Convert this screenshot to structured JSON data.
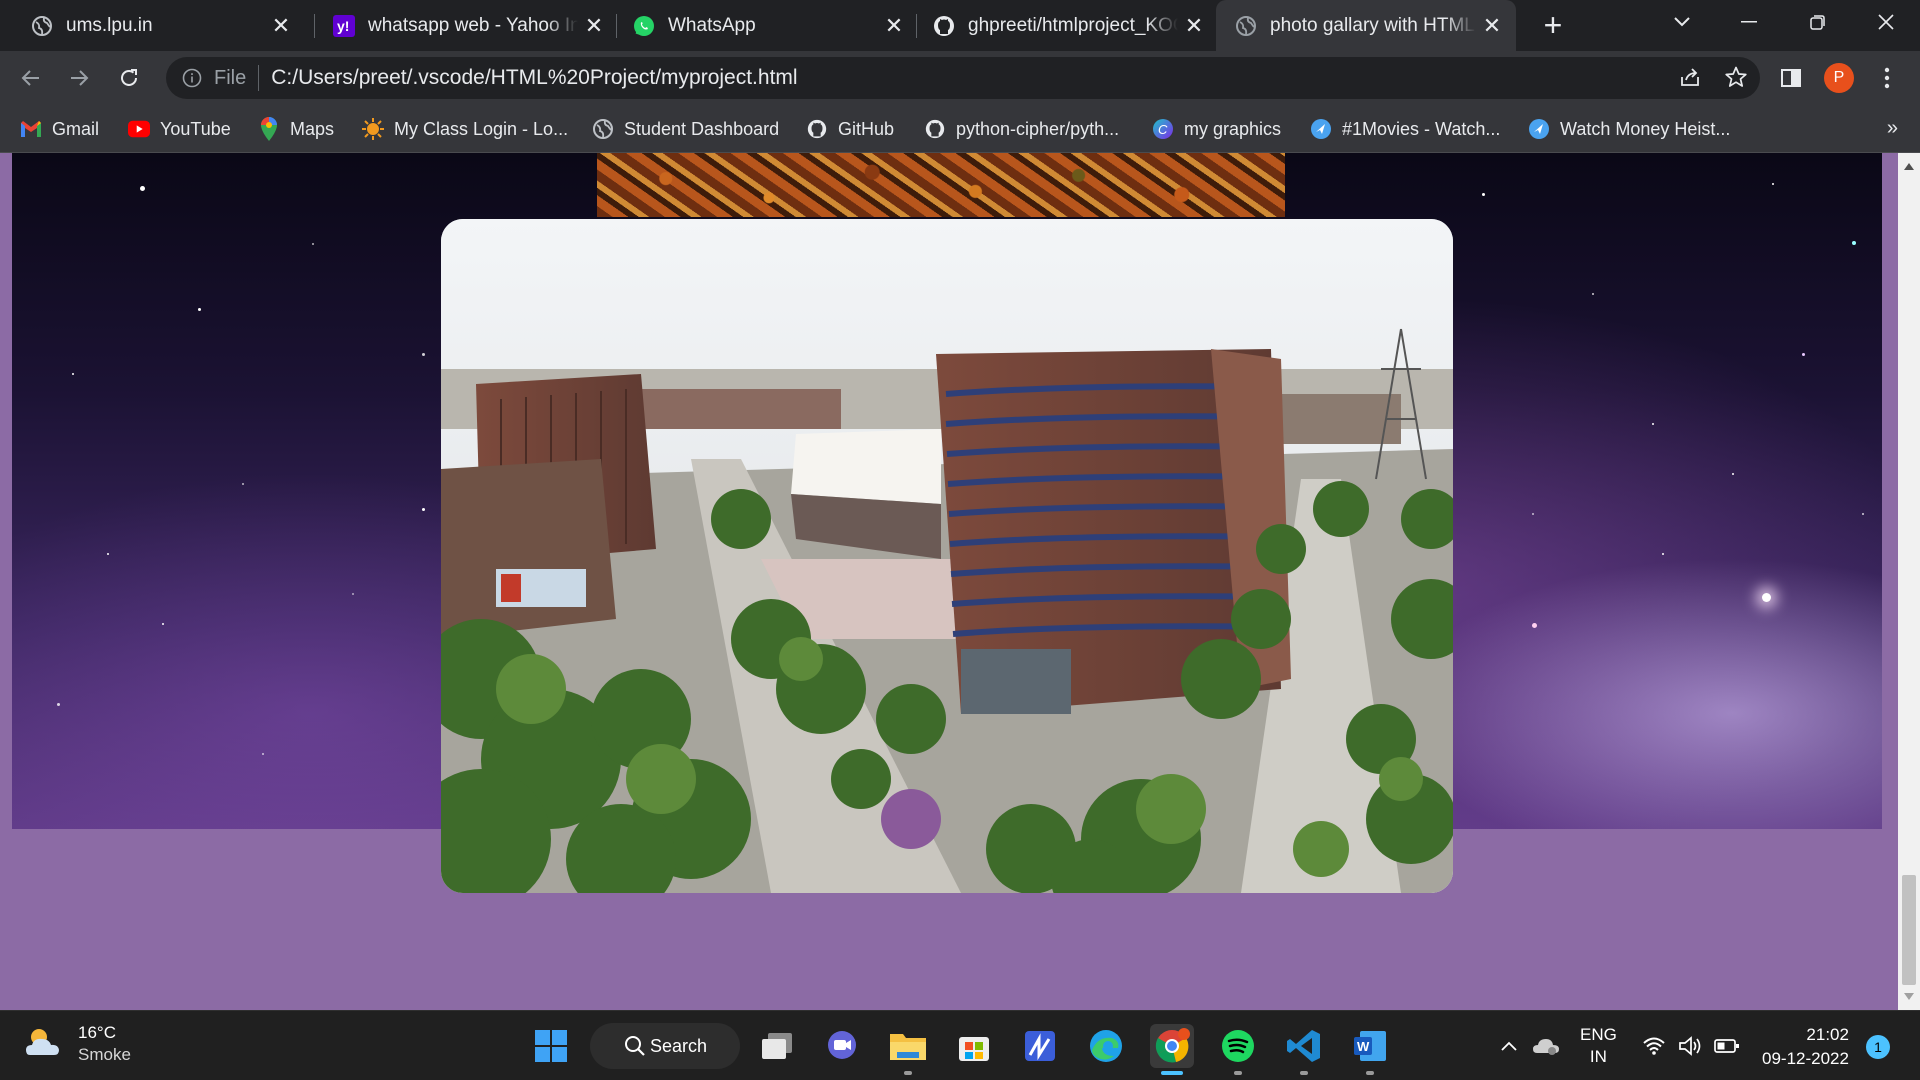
{
  "browser": {
    "tabs": [
      {
        "title": "ums.lpu.in",
        "icon": "globe-icon"
      },
      {
        "title": "whatsapp web - Yahoo India Search",
        "icon": "yahoo-icon"
      },
      {
        "title": "WhatsApp",
        "icon": "whatsapp-icon"
      },
      {
        "title": "ghpreeti/htmlproject_KOOL",
        "icon": "github-icon"
      },
      {
        "title": "photo gallary with HTML and CSS",
        "icon": "globe-icon",
        "active": true
      }
    ],
    "address": {
      "scheme_label": "File",
      "url": "C:/Users/preet/.vscode/HTML%20Project/myproject.html"
    },
    "profile_initial": "P",
    "bookmarks": [
      {
        "label": "Gmail",
        "icon": "gmail-icon"
      },
      {
        "label": "YouTube",
        "icon": "youtube-icon"
      },
      {
        "label": "Maps",
        "icon": "maps-icon"
      },
      {
        "label": "My Class Login - Lo...",
        "icon": "sun-icon"
      },
      {
        "label": "Student Dashboard",
        "icon": "globe-icon"
      },
      {
        "label": "GitHub",
        "icon": "github-icon"
      },
      {
        "label": "python-cipher/pyth...",
        "icon": "github-icon"
      },
      {
        "label": "my graphics",
        "icon": "canva-icon"
      },
      {
        "label": "#1Movies - Watch...",
        "icon": "arrow-icon"
      },
      {
        "label": "Watch Money Heist...",
        "icon": "arrow-icon"
      }
    ],
    "bookmarks_overflow": "»"
  },
  "page": {
    "background_color": "#8c6ba5",
    "main_image": "campus-aerial-photo",
    "top_strip_image": "autumn-leaves-photo"
  },
  "taskbar": {
    "weather": {
      "temp": "16°C",
      "condition": "Smoke",
      "icon": "cloud-sun-icon"
    },
    "search_label": "Search",
    "apps": [
      {
        "name": "windows-start-icon"
      },
      {
        "name": "task-view-icon"
      },
      {
        "name": "chat-icon"
      },
      {
        "name": "file-explorer-icon"
      },
      {
        "name": "store-icon"
      },
      {
        "name": "whiteboard-icon"
      },
      {
        "name": "edge-icon"
      },
      {
        "name": "chrome-icon",
        "active": true
      },
      {
        "name": "spotify-icon"
      },
      {
        "name": "vscode-icon"
      },
      {
        "name": "word-icon"
      }
    ],
    "language": {
      "line1": "ENG",
      "line2": "IN"
    },
    "clock": {
      "time": "21:02",
      "date": "09-12-2022"
    },
    "notification_count": "1"
  }
}
